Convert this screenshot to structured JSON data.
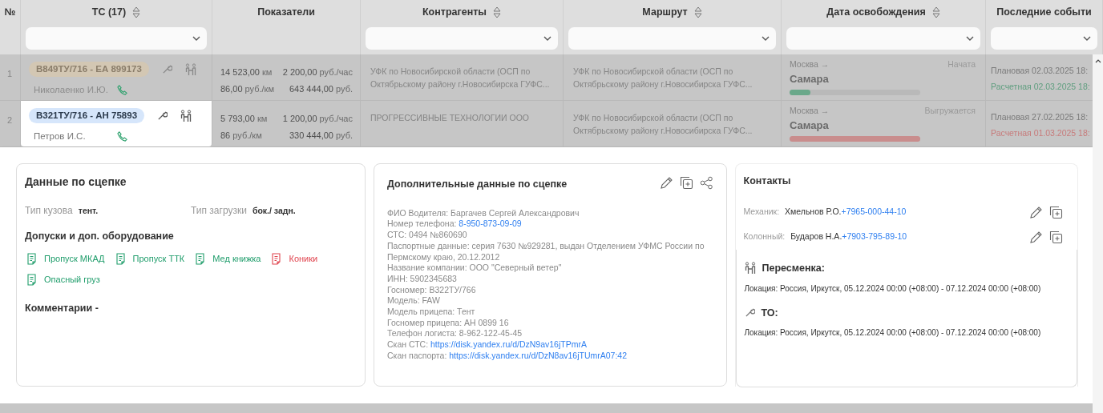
{
  "columns": [
    {
      "label": "№",
      "sortable": false,
      "filter": false
    },
    {
      "label": "ТС (17)",
      "sortable": true,
      "filter": true
    },
    {
      "label": "Показатели",
      "sortable": false,
      "filter": false
    },
    {
      "label": "Контрагенты",
      "sortable": true,
      "filter": true
    },
    {
      "label": "Маршрут",
      "sortable": true,
      "filter": true
    },
    {
      "label": "Дата освобождения",
      "sortable": true,
      "filter": true
    },
    {
      "label": "Последние событи",
      "sortable": false,
      "filter": true
    }
  ],
  "rows": [
    {
      "num": "1",
      "plate": "В849ТУ/716 - ЕА 899173",
      "selected": false,
      "driver": "Николаенко И.Ю.",
      "stats": [
        {
          "value": "14 523,00",
          "unit": "км"
        },
        {
          "value": "2 200,00",
          "unit": "руб./час"
        },
        {
          "value": "86,00",
          "unit": "руб./км"
        },
        {
          "value": "643 444,00",
          "unit": "руб."
        }
      ],
      "counterparty": "УФК по Новосибирской области (ОСП по Октябрьскому району г.Новосибирска ГУФС...",
      "route": "УФК по Новосибирской области (ОСП по Октябрьскому району г.Новосибирска ГУФС...",
      "from": "Москва →",
      "to": "Самара",
      "status": "Начата",
      "level": 0.16,
      "color": "#6aa88a",
      "events": [
        {
          "label": "Плановая",
          "date": "02.03.2025 18:",
          "color": "#7a7a7a"
        },
        {
          "label": "Расчетная",
          "date": "02.03.2025 18:",
          "color": "#5f9e7f"
        }
      ]
    },
    {
      "num": "2",
      "plate": "В321ТУ/716 - АН 75893",
      "selected": true,
      "driver": "Петров И.С.",
      "stats": [
        {
          "value": "5 793,00",
          "unit": "км"
        },
        {
          "value": "1 200,00",
          "unit": "руб./час"
        },
        {
          "value": "86",
          "unit": "руб./км"
        },
        {
          "value": "330 444,00",
          "unit": "руб."
        }
      ],
      "counterparty": "ПРОГРЕССИВНЫЕ ТЕХНОЛОГИИ ООО",
      "route": "УФК по Новосибирской области (ОСП по Октябрьскому району г.Новосибирска ГУФС...",
      "from": "Москва →",
      "to": "Самара",
      "status": "Выгружается",
      "level": 1,
      "color": "#c98d8d",
      "events": [
        {
          "label": "Плановая",
          "date": "27.02.2025 18:",
          "color": "#7a7a7a"
        },
        {
          "label": "Расчетная",
          "date": "01.03.2025 18:",
          "color": "#c77b7b"
        }
      ]
    }
  ],
  "hitch": {
    "title": "Данные по сцепке",
    "fields": [
      {
        "label": "Тип кузова",
        "value": "тент."
      },
      {
        "label": "Тип загрузки",
        "value": "бок./ задн."
      }
    ],
    "permits_title": "Допуски и доп. оборудование",
    "permits": [
      {
        "label": "Пропуск МКАД",
        "valid": true
      },
      {
        "label": "Пропуск ТТК",
        "valid": true
      },
      {
        "label": "Мед книжка",
        "valid": true
      },
      {
        "label": "Коники",
        "valid": false
      },
      {
        "label": "Опасный груз",
        "valid": true
      }
    ],
    "comments": "Комментарии -"
  },
  "extra": {
    "title": "Дополнительные данные по сцепке",
    "lines": [
      {
        "label": "ФИО Водителя:",
        "value": "Баргачев Сергей Александрович",
        "link": false
      },
      {
        "label": "Номер телефона:",
        "value": "8-950-873-09-09",
        "link": true
      },
      {
        "label": "СТС:",
        "value": "0494 №860690",
        "link": false
      },
      {
        "label": "Паспортные данные:",
        "value": "серия 7630 №929281, выдан Отделением УФМС России по Пермскому краю, 20.12.2012",
        "link": false
      },
      {
        "label": "Название компании:",
        "value": "ООО \"Северный ветер\"",
        "link": false
      },
      {
        "label": "ИНН:",
        "value": "5902345683",
        "link": false
      },
      {
        "label": "Госномер:",
        "value": "В322ТУ/766",
        "link": false
      },
      {
        "label": "Модель:",
        "value": "FAW",
        "link": false
      },
      {
        "label": "Модель прицепа:",
        "value": "Тент",
        "link": false
      },
      {
        "label": "Госномер прицепа:",
        "value": "АН 0899 16",
        "link": false
      },
      {
        "label": "Телефон логиста:",
        "value": "8-962-122-45-45",
        "link": false
      },
      {
        "label": "Скан СТС:",
        "value": "https://disk.yandex.ru/d/DzN9av16jTPmrA",
        "link": true
      },
      {
        "label": "Скан паспорта:",
        "value": "https://disk.yandex.ru/d/DzN8av16jTUmrA07:42",
        "link": true
      }
    ]
  },
  "contacts": {
    "title": "Контакты",
    "people": [
      {
        "role": "Механик:",
        "name": "Хмельнов Р.О.",
        "phone": "+7965-000-44-10"
      },
      {
        "role": "Колонный:",
        "name": "Бударов Н.А.",
        "phone": "+7903-795-89-10"
      }
    ],
    "events": [
      {
        "kind": "shift",
        "title": "Пересменка:",
        "text": "Локация: Россия, Иркутск, 05.12.2024 00:00 (+08:00) - 07.12.2024 00:00 (+08:00)"
      },
      {
        "kind": "service",
        "title": "ТО:",
        "text": "Локация: Россия, Иркутск, 05.12.2024 00:00 (+08:00) - 07.12.2024 00:00 (+08:00)"
      }
    ]
  }
}
